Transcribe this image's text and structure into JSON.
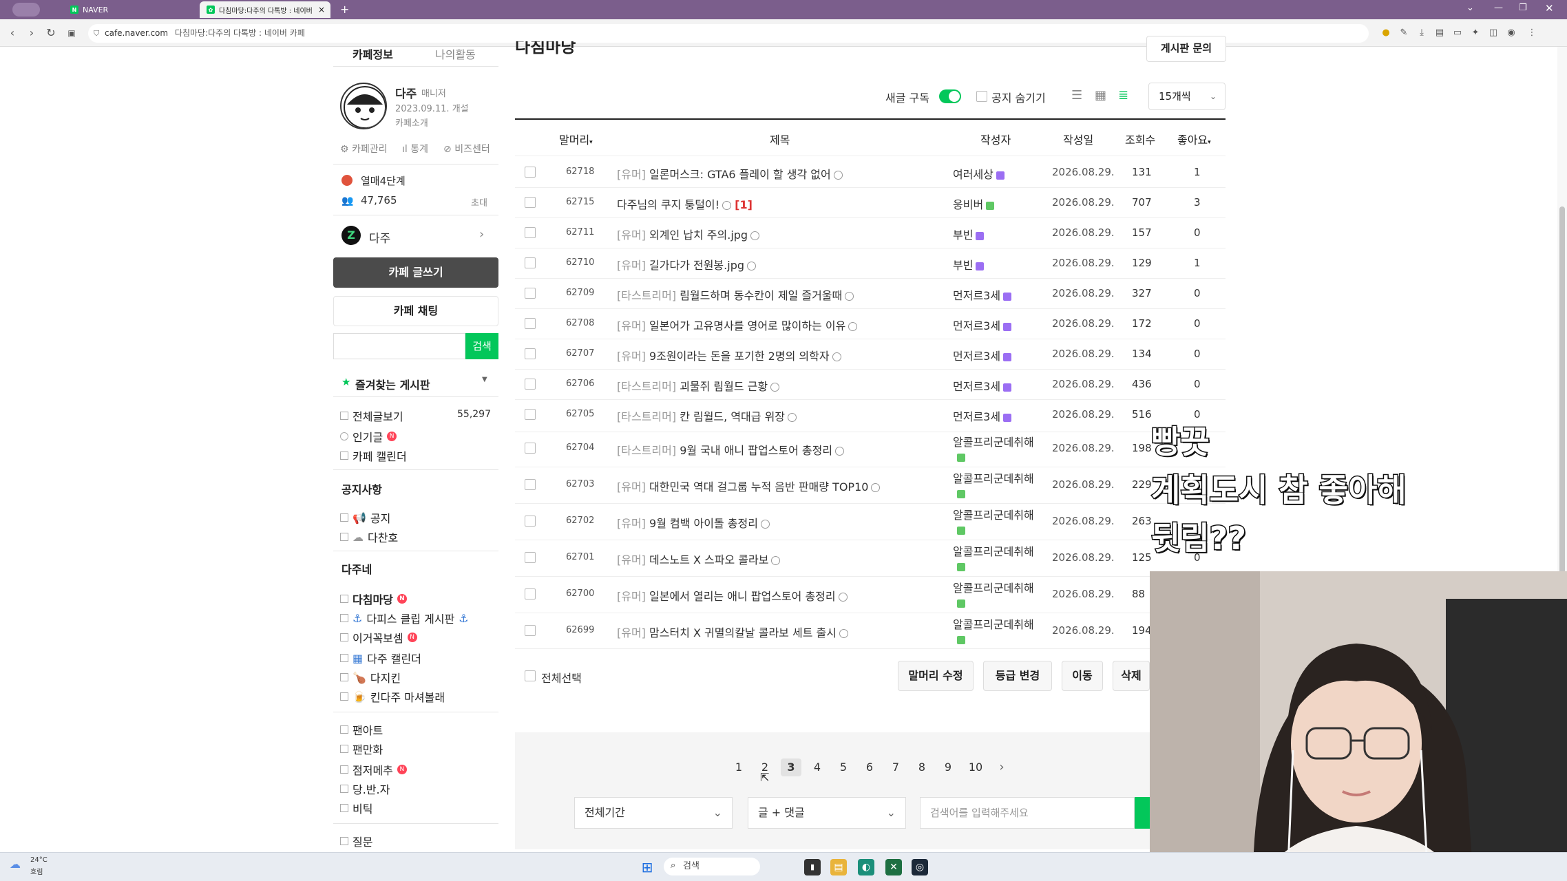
{
  "browser": {
    "tabs": [
      {
        "label": "NAVER"
      },
      {
        "label": "다침마당:다주의 다톡방 : 네이버"
      }
    ],
    "url": "cafe.naver.com",
    "url_title": "다침마당:다주의 다톡방 : 네이버 카페"
  },
  "sidebar": {
    "tabs": [
      "카페정보",
      "나의활동"
    ],
    "manager_name": "다주",
    "manager_role": "매니저",
    "founded": "2023.09.11. 개설",
    "intro": "카페소개",
    "links": [
      "카페관리",
      "통계",
      "비즈센터"
    ],
    "level": "열매4단계",
    "members": "47,765",
    "invite": "초대",
    "cafe_name": "다주",
    "write_button": "카페 글쓰기",
    "chat_button": "카페 채팅",
    "search_button": "검색",
    "favorites_title": "즐겨찾는 게시판",
    "all_posts": "전체글보기",
    "all_posts_count": "55,297",
    "popular": "인기글",
    "calendar": "카페 캘린더",
    "notice_title": "공지사항",
    "notice_items": [
      "공지",
      "다찬호"
    ],
    "daju_title": "다주네",
    "daju_items": [
      "다침마당",
      "다피스 클립 게시판",
      "이거꼭보셈",
      "다주 캘린더",
      "다지킨",
      "킨다주 마셔볼래"
    ],
    "fan_items": [
      "팬아트",
      "팬만화",
      "점저메추",
      "당.반.자",
      "비틱"
    ],
    "last_item": "질문"
  },
  "main": {
    "title": "다침마당",
    "guide_button": "게시판 문의",
    "subscribe_label": "새글 구독",
    "hide_notice_label": "공지 숨기기",
    "per_page": "15개씩",
    "headers": {
      "prefix": "말머리",
      "title": "제목",
      "author": "작성자",
      "date": "작성일",
      "views": "조회수",
      "likes": "좋아요"
    },
    "posts": [
      {
        "no": "62718",
        "prefix": "[유머]",
        "title": "일론머스크: GTA6 플레이 할 생각 없어",
        "comments": "",
        "author": "여러세상",
        "date": "2026.08.29.",
        "views": "131",
        "likes": "1"
      },
      {
        "no": "62715",
        "prefix": "",
        "title": "다주님의 쿠지 퉁털이!",
        "comments": "[1]",
        "author": "웅비버",
        "date": "2026.08.29.",
        "views": "707",
        "likes": "3"
      },
      {
        "no": "62711",
        "prefix": "[유머]",
        "title": "외계인 납치 주의.jpg",
        "comments": "",
        "author": "부빈",
        "date": "2026.08.29.",
        "views": "157",
        "likes": "0"
      },
      {
        "no": "62710",
        "prefix": "[유머]",
        "title": "길가다가 전원봉.jpg",
        "comments": "",
        "author": "부빈",
        "date": "2026.08.29.",
        "views": "129",
        "likes": "1"
      },
      {
        "no": "62709",
        "prefix": "[타스트리머]",
        "title": "림월드하며 동수칸이 제일 즐거울때",
        "comments": "",
        "author": "먼저르3세",
        "date": "2026.08.29.",
        "views": "327",
        "likes": "0"
      },
      {
        "no": "62708",
        "prefix": "[유머]",
        "title": "일본어가 고유명사를 영어로 많이하는 이유",
        "comments": "",
        "author": "먼저르3세",
        "date": "2026.08.29.",
        "views": "172",
        "likes": "0"
      },
      {
        "no": "62707",
        "prefix": "[유머]",
        "title": "9조원이라는 돈을 포기한 2명의 의학자",
        "comments": "",
        "author": "먼저르3세",
        "date": "2026.08.29.",
        "views": "134",
        "likes": "0"
      },
      {
        "no": "62706",
        "prefix": "[타스트리머]",
        "title": "괴물쥐 림월드 근황",
        "comments": "",
        "author": "먼저르3세",
        "date": "2026.08.29.",
        "views": "436",
        "likes": "0"
      },
      {
        "no": "62705",
        "prefix": "[타스트리머]",
        "title": "칸 림월드, 역대급 위장",
        "comments": "",
        "author": "먼저르3세",
        "date": "2026.08.29.",
        "views": "516",
        "likes": "0"
      },
      {
        "no": "62704",
        "prefix": "[타스트리머]",
        "title": "9월 국내 애니 팝업스토어 총정리",
        "comments": "",
        "author": "알콜프리군데취해",
        "date": "2026.08.29.",
        "views": "198",
        "likes": ""
      },
      {
        "no": "62703",
        "prefix": "[유머]",
        "title": "대한민국 역대 걸그룹 누적 음반 판매량 TOP10",
        "comments": "",
        "author": "알콜프리군데취해",
        "date": "2026.08.29.",
        "views": "229",
        "likes": ""
      },
      {
        "no": "62702",
        "prefix": "[유머]",
        "title": "9월 컴백 아이돌 총정리",
        "comments": "",
        "author": "알콜프리군데취해",
        "date": "2026.08.29.",
        "views": "263",
        "likes": ""
      },
      {
        "no": "62701",
        "prefix": "[유머]",
        "title": "데스노트 X 스파오 콜라보",
        "comments": "",
        "author": "알콜프리군데취해",
        "date": "2026.08.29.",
        "views": "125",
        "likes": "0"
      },
      {
        "no": "62700",
        "prefix": "[유머]",
        "title": "일본에서 열리는 애니 팝업스토어 총정리",
        "comments": "",
        "author": "알콜프리군데취해",
        "date": "2026.08.29.",
        "views": "88",
        "likes": ""
      },
      {
        "no": "62699",
        "prefix": "[유머]",
        "title": "맘스터치 X 귀멸의칼날 콜라보 세트 출시",
        "comments": "",
        "author": "알콜프리군데취해",
        "date": "2026.08.29.",
        "views": "194",
        "likes": ""
      }
    ],
    "select_all": "전체선택",
    "actions": [
      "말머리 수정",
      "등급 변경",
      "이동",
      "삭제"
    ],
    "pages": [
      "1",
      "2",
      "3",
      "4",
      "5",
      "6",
      "7",
      "8",
      "9",
      "10"
    ],
    "current_page": "3",
    "next": "›",
    "period_select": "전체기간",
    "scope_select": "글 + 댓글",
    "search_placeholder": "검색어를 입력해주세요"
  },
  "overlay": {
    "captions": [
      "빵끗",
      "계획도시 참 좋아해",
      "뒷림??"
    ]
  },
  "taskbar": {
    "weather_temp": "24°C",
    "weather_desc": "흐림",
    "search": "검색"
  },
  "colors": {
    "accent": "#03c75a",
    "tabbar": "#7b5e8c",
    "level_badge": "#9b6ef3",
    "new_badge": "#ff4458"
  }
}
